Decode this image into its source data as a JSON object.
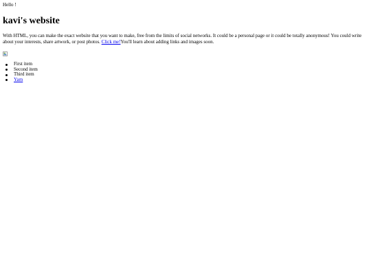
{
  "greeting": "Hello !",
  "title": "kavi's website",
  "intro": {
    "text_before": "With HTML, you can make the exact website that you want to make, free from the limits of social networks. It could be a personal page or it could be totally anonymous! You could write about your interests, share artwork, or post photos.",
    "link_label": "Click me!",
    "text_after": "You'll learn about adding links and images soon."
  },
  "image": {
    "icon": "broken-image-icon"
  },
  "list": {
    "items": [
      "First item",
      "Second item",
      "Third item"
    ],
    "link_item": "Yarn"
  },
  "colors": {
    "link": "#0000ee",
    "text": "#000000",
    "background": "#ffffff"
  }
}
